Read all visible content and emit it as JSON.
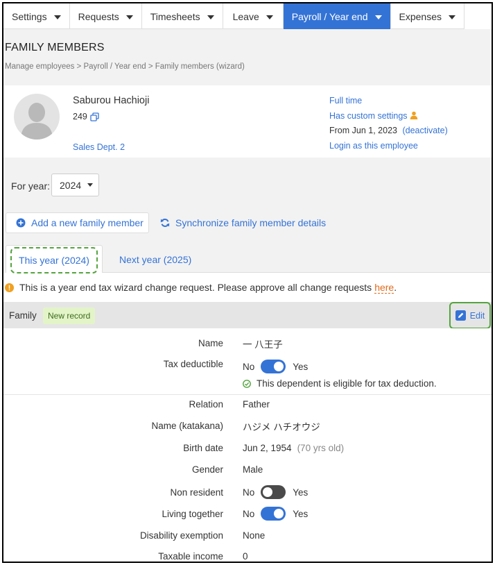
{
  "nav": {
    "items": [
      {
        "label": "Settings",
        "active": false
      },
      {
        "label": "Requests",
        "active": false
      },
      {
        "label": "Timesheets",
        "active": false
      },
      {
        "label": "Leave",
        "active": false
      },
      {
        "label": "Payroll / Year end",
        "active": true
      },
      {
        "label": "Expenses",
        "active": false
      }
    ]
  },
  "page": {
    "title": "FAMILY MEMBERS",
    "breadcrumb": "Manage employees > Payroll / Year end > Family members (wizard)"
  },
  "employee": {
    "name": "Saburou Hachioji",
    "id": "249",
    "department": "Sales Dept. 2",
    "employment_type": "Full time",
    "custom_settings": "Has custom settings",
    "from_date": "From Jun 1, 2023",
    "deactivate": "(deactivate)",
    "login_as": "Login as this employee"
  },
  "year_filter": {
    "label": "For year:",
    "selected": "2024"
  },
  "actions": {
    "add_member": "Add a new family member",
    "sync": "Synchronize family member details"
  },
  "tabs": {
    "this_year": "This year (2024)",
    "next_year": "Next year (2025)"
  },
  "notice": {
    "text": "This is a year end tax wizard change request. Please approve all change requests",
    "link": "here",
    "period": "."
  },
  "family": {
    "section_label": "Family",
    "badge": "New record",
    "edit_label": "Edit"
  },
  "fields": {
    "name": {
      "label": "Name",
      "value": "一 八王子"
    },
    "tax_deductible": {
      "label": "Tax deductible",
      "no": "No",
      "yes": "Yes",
      "on": true
    },
    "eligible_note": "This dependent is eligible for tax deduction.",
    "relation": {
      "label": "Relation",
      "value": "Father"
    },
    "name_katakana": {
      "label": "Name (katakana)",
      "value": "ハジメ ハチオウジ"
    },
    "birth_date": {
      "label": "Birth date",
      "value": "Jun 2, 1954",
      "age": "(70 yrs old)"
    },
    "gender": {
      "label": "Gender",
      "value": "Male"
    },
    "non_resident": {
      "label": "Non resident",
      "no": "No",
      "yes": "Yes",
      "on": false
    },
    "living_together": {
      "label": "Living together",
      "no": "No",
      "yes": "Yes",
      "on": true
    },
    "disability": {
      "label": "Disability exemption",
      "value": "None"
    },
    "taxable_income": {
      "label": "Taxable income",
      "value": "0"
    }
  },
  "colors": {
    "accent": "#3473d6",
    "highlight": "#53a43d",
    "badge_bg": "#e3f4c8",
    "link_orange": "#e06a1a",
    "info_orange": "#f0a020"
  }
}
